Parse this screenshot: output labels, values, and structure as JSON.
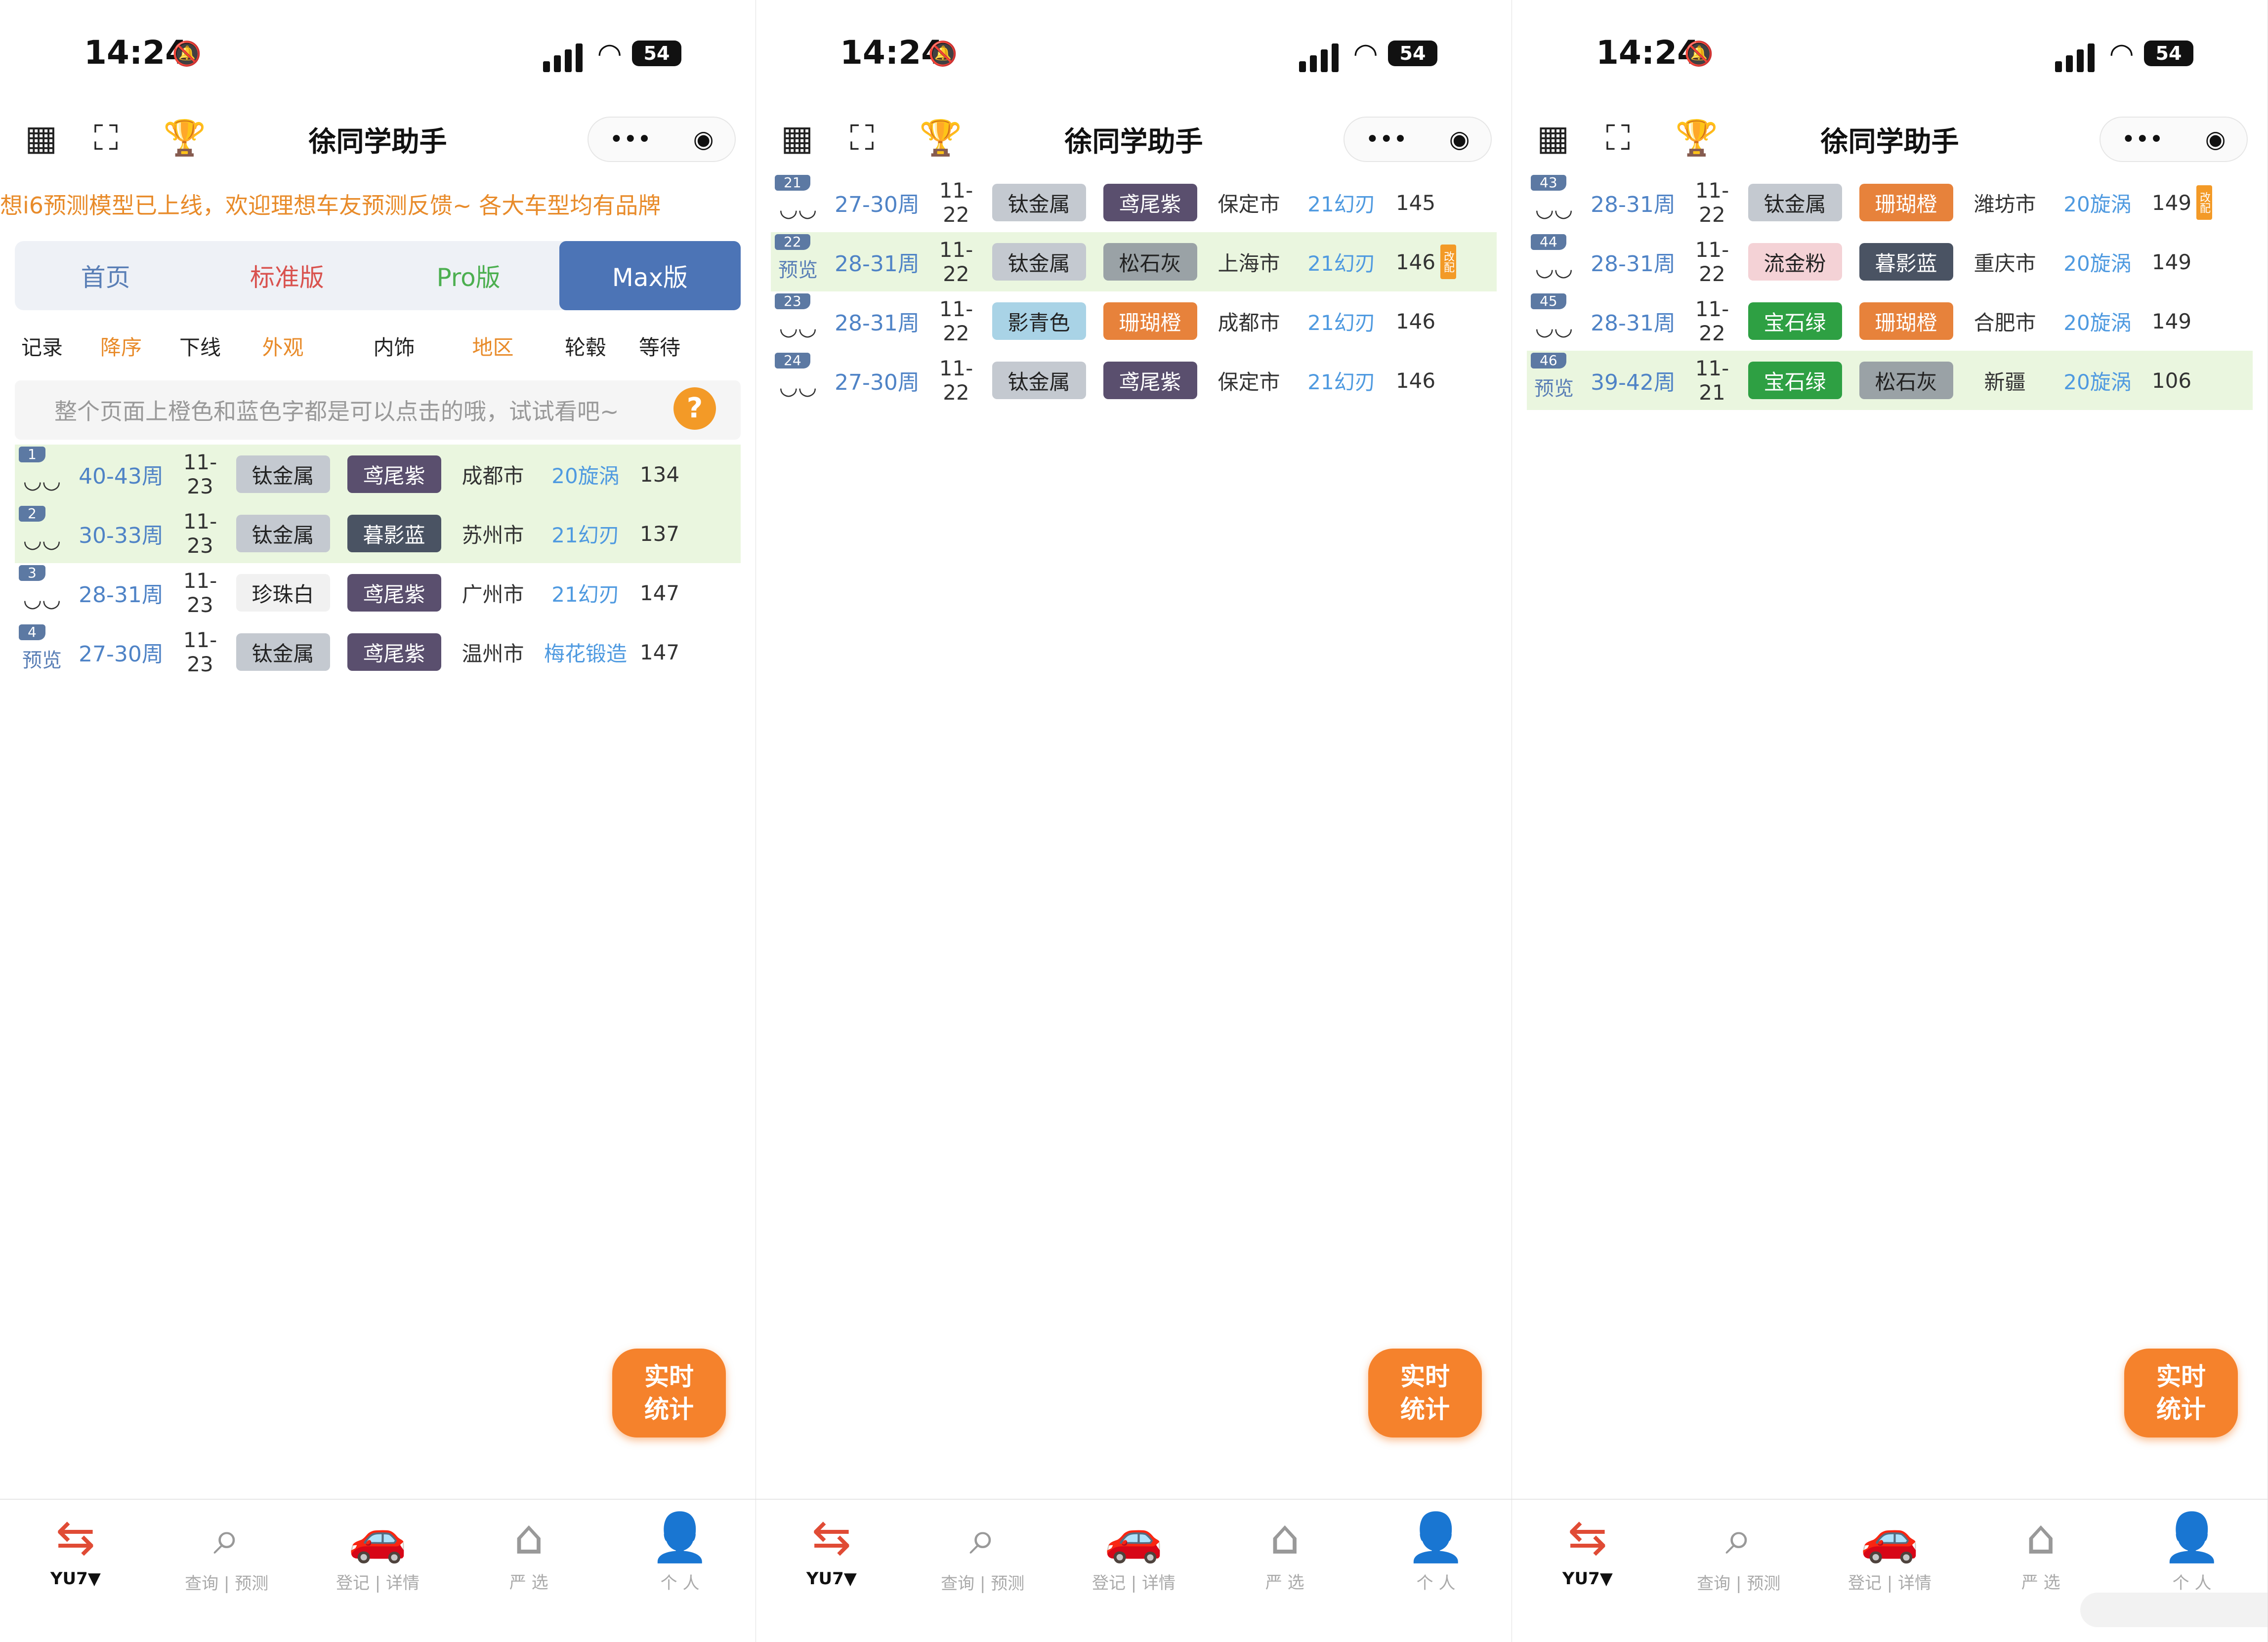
{
  "status": {
    "time": "14:24",
    "battery": "54"
  },
  "app": {
    "title": "徐同学助手"
  },
  "ticker": "想i6预测模型已上线，欢迎理想车友预测反馈~    各大车型均有品牌",
  "tabs": [
    {
      "label": "首页",
      "color": "#5a7fb6"
    },
    {
      "label": "标准版",
      "color": "#d9534f"
    },
    {
      "label": "Pro版",
      "color": "#4caf50"
    },
    {
      "label": "Max版",
      "color": "#ffffff"
    }
  ],
  "columns": [
    {
      "label": "记录",
      "color": "#222"
    },
    {
      "label": "降序",
      "color": "#e88b2a"
    },
    {
      "label": "下线",
      "color": "#222"
    },
    {
      "label": "外观",
      "color": "#e88b2a"
    },
    {
      "label": "内饰",
      "color": "#222"
    },
    {
      "label": "地区",
      "color": "#e88b2a"
    },
    {
      "label": "轮毂",
      "color": "#222"
    },
    {
      "label": "等待",
      "color": "#222"
    }
  ],
  "hint": "整个页面上橙色和蓝色字都是可以点击的哦，试试看吧~",
  "fab": {
    "line1": "实时",
    "line2": "统计"
  },
  "tabbar": [
    {
      "icon": "⇆",
      "label": "YU7▼"
    },
    {
      "icon": "⌕",
      "label": "查询 | 预测"
    },
    {
      "icon": "🚗",
      "label": "登记 | 详情"
    },
    {
      "icon": "⌂",
      "label": "严 选"
    },
    {
      "icon": "👤",
      "label": "个 人"
    }
  ],
  "colors": {
    "钛金属": "#c4c9d0",
    "鸢尾紫": "#5a4f6e",
    "暮影蓝": "#4a5363",
    "珍珠白": "#f1f1f1",
    "宝石绿": "#2ea043",
    "珊瑚橙": "#e7823b",
    "流金粉": "#f4d2d6",
    "松石灰": "#9aa2a6",
    "影青色": "#a9d3e6",
    "寒武岩灰": "#6b6f75",
    "丹霞紫": "#e7b8c2",
    "深海蓝": "#5b79b8"
  },
  "panels": [
    {
      "rows": [
        {
          "n": "1",
          "rec": "eye",
          "wk": "40-43周",
          "date": "11-23",
          "ext": "钛金属",
          "int": "鸢尾紫",
          "area": "成都市",
          "wheel": "20旋涡",
          "wait": "134",
          "mod": false,
          "green": true
        },
        {
          "n": "2",
          "rec": "eye",
          "wk": "30-33周",
          "date": "11-23",
          "ext": "钛金属",
          "int": "暮影蓝",
          "area": "苏州市",
          "wheel": "21幻刃",
          "wait": "137",
          "mod": false,
          "green": true
        },
        {
          "n": "3",
          "rec": "eye",
          "wk": "28-31周",
          "date": "11-23",
          "ext": "珍珠白",
          "int": "鸢尾紫",
          "area": "广州市",
          "wheel": "21幻刃",
          "wait": "147",
          "mod": false,
          "green": false
        },
        {
          "n": "4",
          "rec": "预览",
          "wk": "27-30周",
          "date": "11-23",
          "ext": "钛金属",
          "int": "鸢尾紫",
          "area": "温州市",
          "wheel": "梅花锻造",
          "wait": "147",
          "mod": false,
          "green": false
        }
      ]
    },
    {
      "rows": [
        {
          "n": "21",
          "rec": "eye",
          "wk": "27-30周",
          "date": "11-22",
          "ext": "钛金属",
          "int": "鸢尾紫",
          "area": "保定市",
          "wheel": "21幻刃",
          "wait": "145",
          "mod": false,
          "green": false
        },
        {
          "n": "22",
          "rec": "预览",
          "wk": "28-31周",
          "date": "11-22",
          "ext": "钛金属",
          "int": "松石灰",
          "area": "上海市",
          "wheel": "21幻刃",
          "wait": "146",
          "mod": true,
          "green": true
        },
        {
          "n": "23",
          "rec": "eye",
          "wk": "28-31周",
          "date": "11-22",
          "ext": "影青色",
          "int": "珊瑚橙",
          "area": "成都市",
          "wheel": "21幻刃",
          "wait": "146",
          "mod": false,
          "green": false
        },
        {
          "n": "24",
          "rec": "eye",
          "wk": "27-30周",
          "date": "11-22",
          "ext": "钛金属",
          "int": "鸢尾紫",
          "area": "保定市",
          "wheel": "21幻刃",
          "wait": "146",
          "mod": false,
          "green": false
        }
      ]
    },
    {
      "rows": [
        {
          "n": "43",
          "rec": "eye",
          "wk": "28-31周",
          "date": "11-22",
          "ext": "钛金属",
          "int": "珊瑚橙",
          "area": "潍坊市",
          "wheel": "20旋涡",
          "wait": "149",
          "mod": true,
          "green": false
        },
        {
          "n": "44",
          "rec": "eye",
          "wk": "28-31周",
          "date": "11-22",
          "ext": "流金粉",
          "int": "暮影蓝",
          "area": "重庆市",
          "wheel": "20旋涡",
          "wait": "149",
          "mod": false,
          "green": false
        },
        {
          "n": "45",
          "rec": "eye",
          "wk": "28-31周",
          "date": "11-22",
          "ext": "宝石绿",
          "int": "珊瑚橙",
          "area": "合肥市",
          "wheel": "20旋涡",
          "wait": "149",
          "mod": false,
          "green": false
        },
        {
          "n": "46",
          "rec": "预览",
          "wk": "39-42周",
          "date": "11-21",
          "ext": "宝石绿",
          "int": "松石灰",
          "area": "新疆",
          "wheel": "20旋涡",
          "wait": "106",
          "mod": false,
          "green": true
        }
      ]
    }
  ]
}
